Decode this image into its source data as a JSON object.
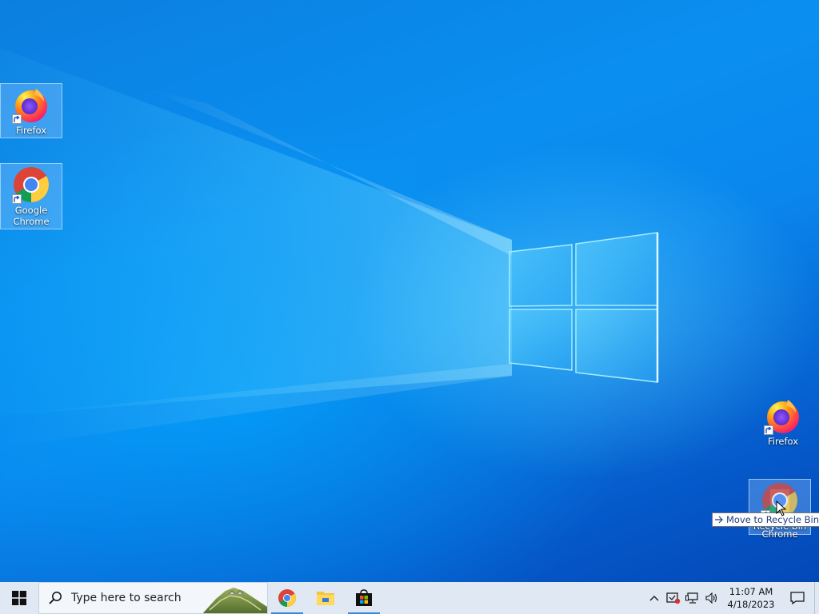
{
  "desktop": {
    "icons": [
      {
        "label": "Firefox",
        "app": "firefox-icon"
      },
      {
        "label": "Google Chrome",
        "app": "chrome-icon"
      },
      {
        "label": "Firefox",
        "app": "firefox-icon"
      },
      {
        "label": "Recycle Bin",
        "app": "recycle-bin-icon"
      },
      {
        "label": "Chrome",
        "app": "chrome-icon"
      }
    ],
    "drag_tooltip": "Move to Recycle Bin"
  },
  "taskbar": {
    "search_placeholder": "Type here to search",
    "pinned_apps": [
      "chrome-icon",
      "file-explorer-icon",
      "microsoft-store-icon"
    ],
    "tray_icons": [
      "chevron-up-icon",
      "security-icon",
      "network-icon",
      "volume-icon"
    ],
    "clock": {
      "time": "11:07 AM",
      "date": "4/18/2023"
    },
    "notification_icon": "notification-icon"
  },
  "colors": {
    "wallpaper": "#0a86ec",
    "taskbar": "#dfe8f3",
    "accent": "#3a86d8"
  }
}
